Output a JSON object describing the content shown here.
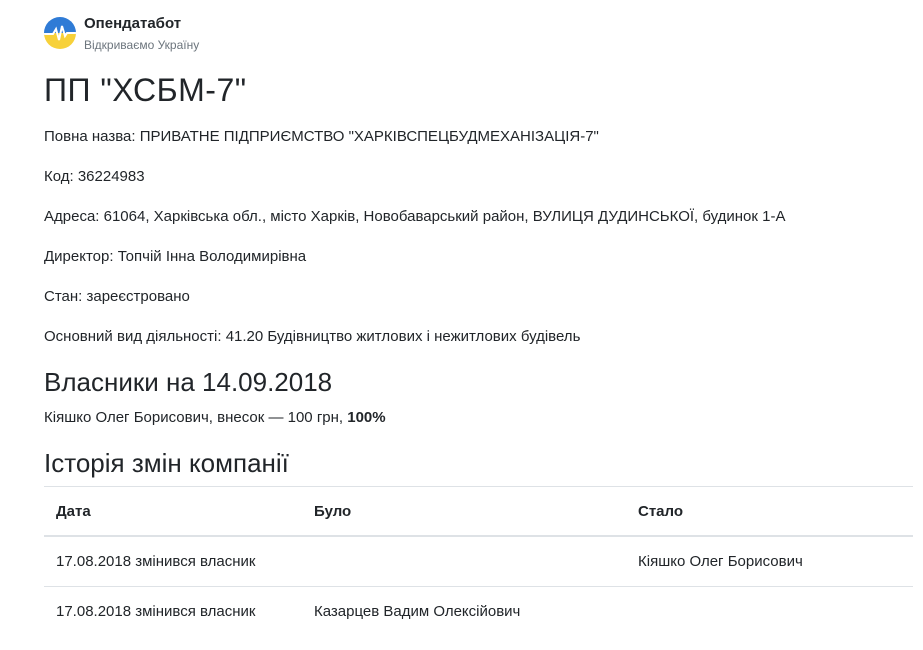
{
  "brand": {
    "name": "Опендатабот",
    "tagline": "Відкриваємо Україну",
    "colors": {
      "blue": "#2f7bd6",
      "yellow": "#f7d13a"
    }
  },
  "company": {
    "title": "ПП \"ХСБМ-7\"",
    "fields": [
      {
        "label": "Повна назва:",
        "value": "ПРИВАТНЕ ПІДПРИЄМСТВО \"ХАРКІВСПЕЦБУДМЕХАНІЗАЦІЯ-7\""
      },
      {
        "label": "Код:",
        "value": "36224983"
      },
      {
        "label": "Адреса:",
        "value": "61064, Харківська обл., місто Харків, Новобаварський район, ВУЛИЦЯ ДУДИНСЬКОЇ, будинок 1-А"
      },
      {
        "label": "Директор:",
        "value": "Топчій Інна Володимирівна"
      },
      {
        "label": "Стан:",
        "value": "зареєстровано"
      },
      {
        "label": "Основний вид діяльності:",
        "value": "41.20 Будівництво житлових і нежитлових будівель"
      }
    ]
  },
  "owners": {
    "heading": "Власники на 14.09.2018",
    "entry": {
      "text": "Кіяшко Олег Борисович, внесок — 100 грн,",
      "share": "100%"
    }
  },
  "history": {
    "heading": "Історія змін компанії",
    "columns": [
      "Дата",
      "Було",
      "Стало"
    ],
    "rows": [
      {
        "date": "17.08.2018 змінився власник",
        "was": "",
        "became": "Кіяшко Олег Борисович"
      },
      {
        "date": "17.08.2018 змінився власник",
        "was": "Казарцев Вадим Олексійович",
        "became": ""
      }
    ]
  }
}
